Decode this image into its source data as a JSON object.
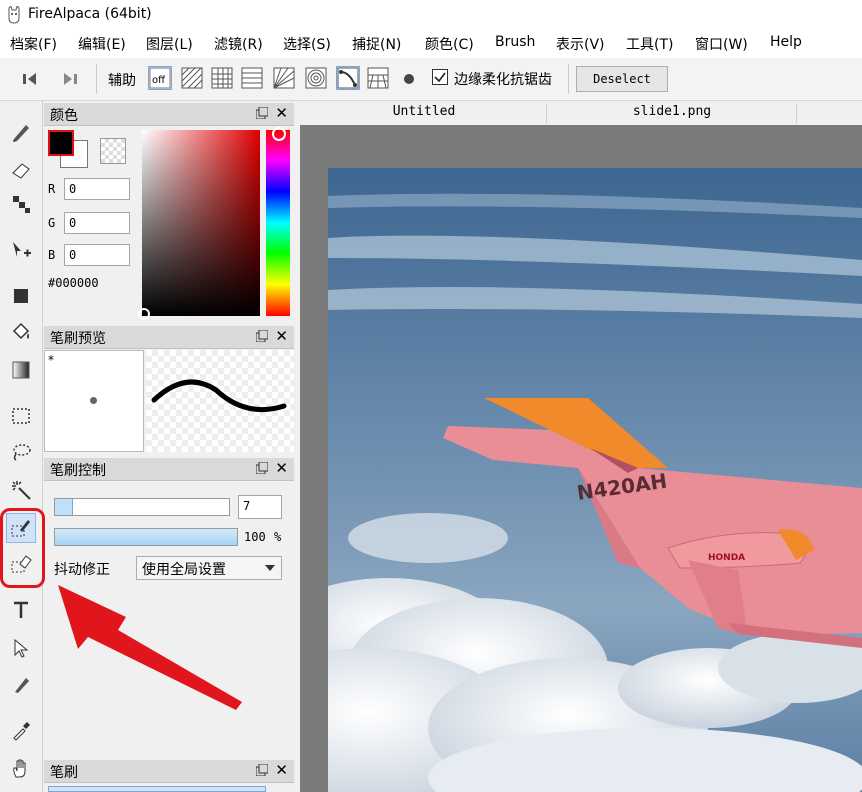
{
  "window": {
    "title": "FireAlpaca (64bit)"
  },
  "menu": [
    "档案(F)",
    "编辑(E)",
    "图层(L)",
    "滤镜(R)",
    "选择(S)",
    "捕捉(N)",
    "颜色(C)",
    "Brush",
    "表示(V)",
    "工具(T)",
    "窗口(W)",
    "Help"
  ],
  "toolbar": {
    "guide_label": "辅助",
    "guide_off": "off",
    "antialias_label": "边缘柔化抗锯齿",
    "antialias_checked": true,
    "deselect_label": "Deselect"
  },
  "color_panel": {
    "title": "颜色",
    "r_label": "R",
    "r_value": "0",
    "g_label": "G",
    "g_value": "0",
    "b_label": "B",
    "b_value": "0",
    "hex": "#000000",
    "primary_color": "#000000"
  },
  "brush_preview_panel": {
    "title": "笔刷预览",
    "marker": "*"
  },
  "brush_control_panel": {
    "title": "笔刷控制",
    "size_value": "7",
    "size_fraction": 0.1,
    "opacity_value": "100",
    "opacity_unit": "%",
    "opacity_fraction": 1.0,
    "stabilizer_label": "抖动修正",
    "stabilizer_option": "使用全局设置"
  },
  "brush_panel": {
    "title": "笔刷"
  },
  "documents": {
    "tabs": [
      "Untitled",
      "slide1.png"
    ]
  },
  "image": {
    "tail_text": "N420AH",
    "engine_text": "HONDA"
  }
}
